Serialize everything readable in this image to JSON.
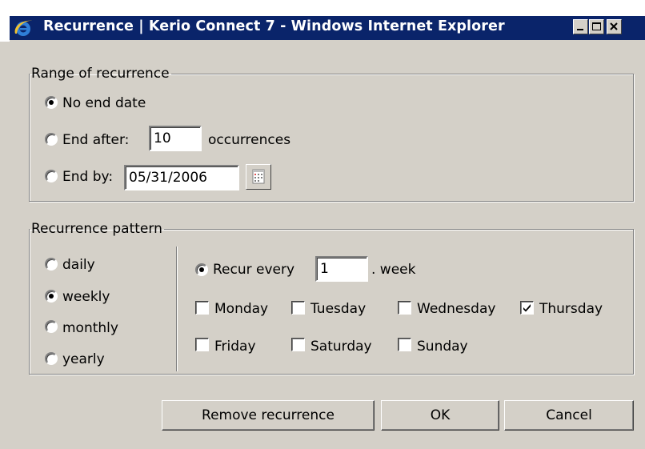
{
  "window": {
    "title": "Recurrence | Kerio Connect 7 - Windows Internet Explorer",
    "controls": {
      "minimize": "minimize",
      "maximize": "maximize",
      "close": "close"
    }
  },
  "range": {
    "legend": "Range of recurrence",
    "no_end_label": "No end date",
    "end_after_label": "End after:",
    "end_after_value": "10",
    "occurrences_label": "occurrences",
    "end_by_label": "End by:",
    "end_by_value": "05/31/2006",
    "selected": "no_end"
  },
  "pattern": {
    "legend": "Recurrence pattern",
    "frequencies": [
      {
        "label": "daily",
        "checked": false
      },
      {
        "label": "weekly",
        "checked": true
      },
      {
        "label": "monthly",
        "checked": false
      },
      {
        "label": "yearly",
        "checked": false
      }
    ],
    "recur_every_label": "Recur every",
    "recur_every_value": "1",
    "week_label": ". week",
    "days": [
      {
        "label": "Monday",
        "checked": false
      },
      {
        "label": "Tuesday",
        "checked": false
      },
      {
        "label": "Wednesday",
        "checked": false
      },
      {
        "label": "Thursday",
        "checked": true
      },
      {
        "label": "Friday",
        "checked": false
      },
      {
        "label": "Saturday",
        "checked": false
      },
      {
        "label": "Sunday",
        "checked": false
      }
    ]
  },
  "buttons": {
    "remove": "Remove recurrence",
    "ok": "OK",
    "cancel": "Cancel"
  },
  "colors": {
    "titlebar": "#0a246a",
    "dialog_bg": "#d4d0c8"
  }
}
